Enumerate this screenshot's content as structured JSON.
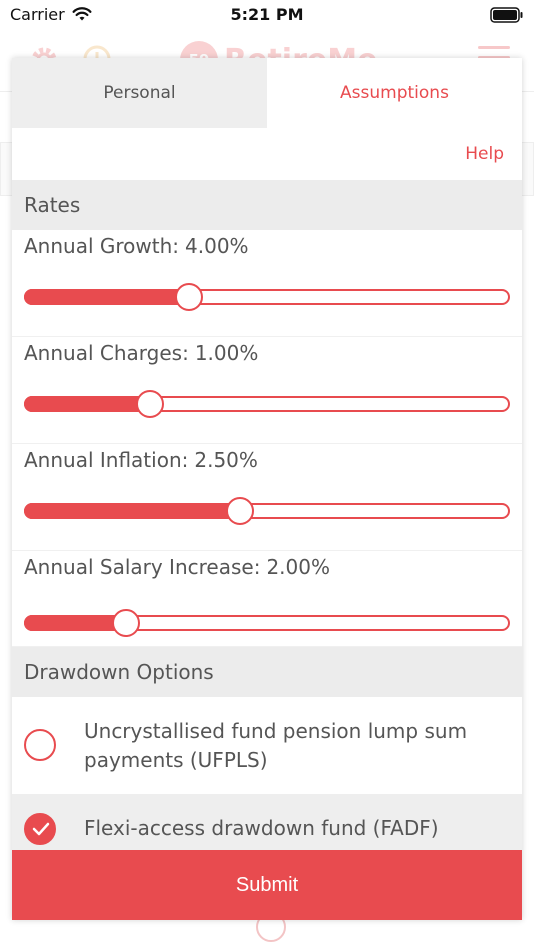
{
  "status_bar": {
    "carrier": "Carrier",
    "time": "5:21 PM"
  },
  "background": {
    "logo_badge": "59",
    "logo_text": "RetireMe"
  },
  "tabs": [
    {
      "label": "Personal",
      "active": false
    },
    {
      "label": "Assumptions",
      "active": true
    }
  ],
  "help_label": "Help",
  "sections": {
    "rates": "Rates",
    "drawdown": "Drawdown Options"
  },
  "rates": [
    {
      "label": "Annual Growth:",
      "value": "4.00%",
      "fraction": 0.34
    },
    {
      "label": "Annual Charges:",
      "value": "1.00%",
      "fraction": 0.26
    },
    {
      "label": "Annual Inflation:",
      "value": "2.50%",
      "fraction": 0.445
    },
    {
      "label": "Annual Salary Increase:",
      "value": "2.00%",
      "fraction": 0.21
    }
  ],
  "drawdown_options": [
    {
      "label": "Uncrystallised fund pension lump sum payments (UFPLS)",
      "selected": false
    },
    {
      "label": "Flexi-access drawdown fund (FADF)",
      "selected": true
    }
  ],
  "submit_label": "Submit",
  "colors": {
    "accent": "#e84b4f",
    "tab_inactive": "#eeeeee",
    "section_bg": "#ececec"
  }
}
